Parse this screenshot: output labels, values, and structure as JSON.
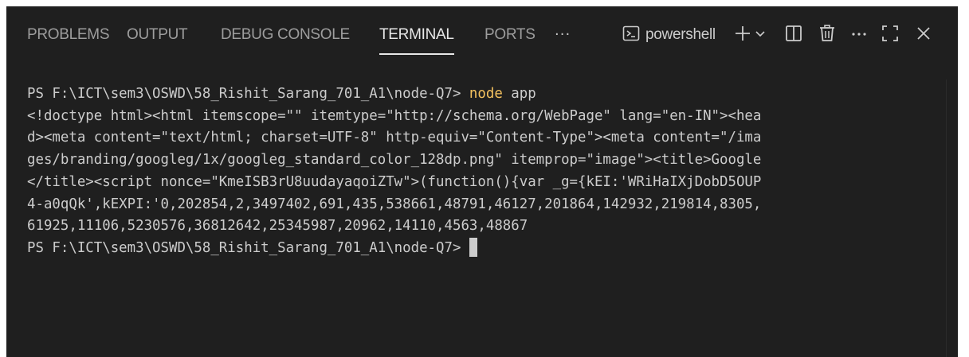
{
  "tabs": [
    {
      "label": "PROBLEMS"
    },
    {
      "label": "OUTPUT"
    },
    {
      "label": "DEBUG CONSOLE"
    },
    {
      "label": "TERMINAL",
      "active": true
    },
    {
      "label": "PORTS"
    }
  ],
  "more_label": "···",
  "toolbar": {
    "shell_name": "powershell",
    "icons": [
      "terminal-icon",
      "plus-icon",
      "chevron-down-icon",
      "split-icon",
      "trash-icon",
      "more-icon",
      "maximize-icon",
      "close-icon"
    ]
  },
  "terminal": {
    "prompt": "PS F:\\ICT\\sem3\\OSWD\\58_Rishit_Sarang_701_A1\\node-Q7> ",
    "command": "node",
    "command_args": " app",
    "output_lines": [
      "<!doctype html><html itemscope=\"\" itemtype=\"http://schema.org/WebPage\" lang=\"en-IN\"><hea",
      "d><meta content=\"text/html; charset=UTF-8\" http-equiv=\"Content-Type\"><meta content=\"/ima",
      "ges/branding/googleg/1x/googleg_standard_color_128dp.png\" itemprop=\"image\"><title>Google",
      "</title><script nonce=\"KmeISB3rU8uudayaqoiZTw\">(function(){var _g={kEI:'WRiHaIXjDobD5OUP",
      "4-a0qQk',kEXPI:'0,202854,2,3497402,691,435,538661,48791,46127,201864,142932,219814,8305,",
      "61925,11106,5230576,36812642,25345987,20962,14110,4563,48867"
    ],
    "final_prompt": "PS F:\\ICT\\sem3\\OSWD\\58_Rishit_Sarang_701_A1\\node-Q7> "
  },
  "colors": {
    "background": "#1f1f1f",
    "text": "#cccccc",
    "command": "#f5c25f",
    "active_tab": "#e7e7e7"
  }
}
